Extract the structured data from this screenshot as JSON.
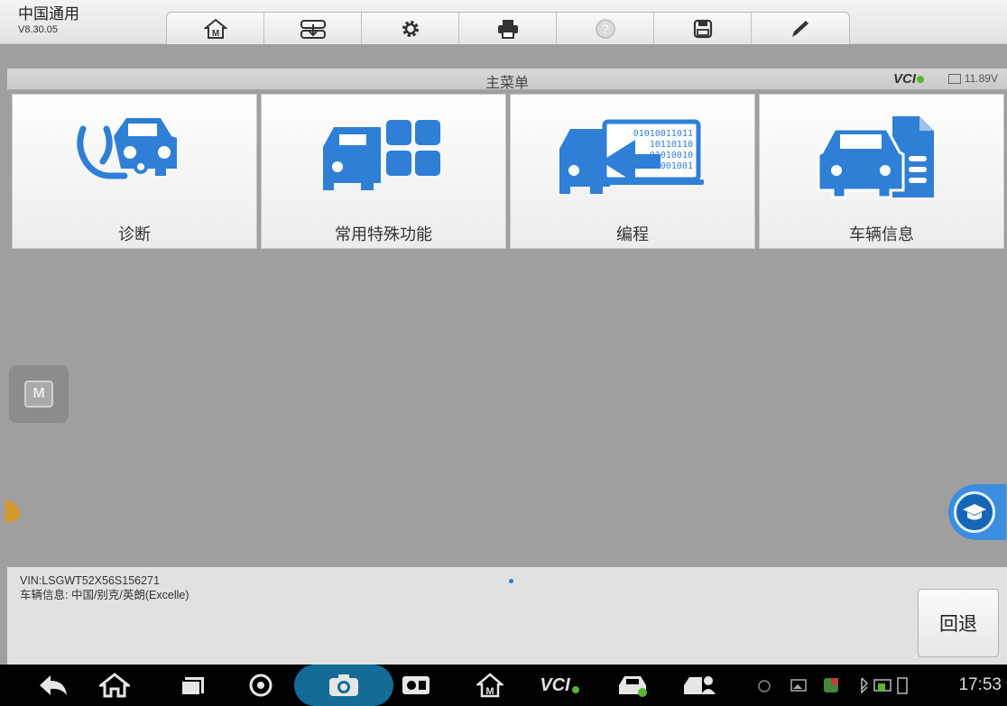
{
  "app": {
    "name": "中国通用",
    "version": "V8.30.05"
  },
  "toolbar": {
    "buttons": [
      {
        "icon": "home-icon"
      },
      {
        "icon": "vehicle-swap-icon"
      },
      {
        "icon": "settings-gear-icon"
      },
      {
        "icon": "print-icon"
      },
      {
        "icon": "help-icon"
      },
      {
        "icon": "save-icon"
      },
      {
        "icon": "pen-icon"
      }
    ]
  },
  "titlebar": {
    "title": "主菜单",
    "vci": "VCI",
    "battery": "11.89V"
  },
  "tiles": [
    {
      "label": "诊断",
      "icon": "diagnosis-stethoscope-car-icon"
    },
    {
      "label": "常用特殊功能",
      "icon": "special-functions-car-grid-icon"
    },
    {
      "label": "编程",
      "icon": "programming-binary-car-icon"
    },
    {
      "label": "车辆信息",
      "icon": "vehicle-info-car-document-icon"
    }
  ],
  "vehicle": {
    "vin": "VIN:LSGWT52X56S156271",
    "info": "车辆信息: 中国/别克/英朗(Excelle)"
  },
  "buttons": {
    "back": "回退"
  },
  "statusbar": {
    "vci": "VCI",
    "time": "17:53"
  },
  "colors": {
    "accent": "#2f7fd6",
    "background": "#9f9f9f",
    "nav": "#000000"
  }
}
